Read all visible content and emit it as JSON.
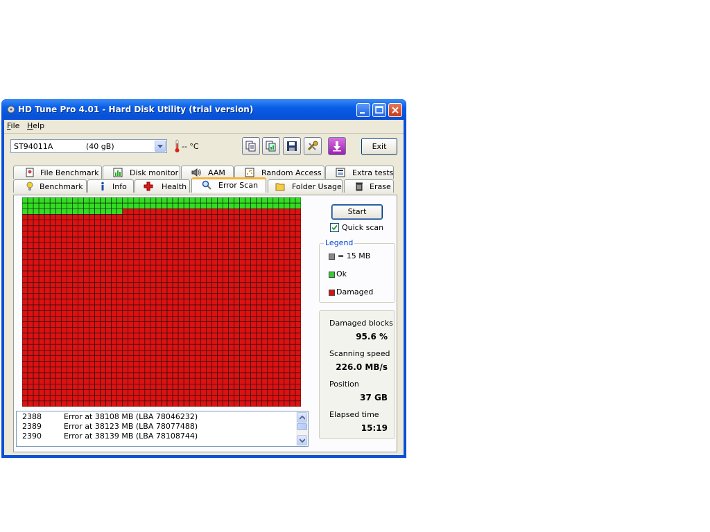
{
  "window": {
    "title": "HD Tune Pro 4.01 - Hard Disk Utility (trial version)"
  },
  "menu": {
    "items": [
      "File",
      "Help"
    ]
  },
  "toolbar": {
    "drive_model": "ST94011A",
    "drive_size": "(40 gB)",
    "temperature": "-- °C",
    "exit_label": "Exit",
    "icon_buttons": [
      "copy-text-icon",
      "copy-screenshot-icon",
      "save-icon",
      "options-icon",
      "download-icon"
    ]
  },
  "tabs": {
    "row1": [
      {
        "label": "File Benchmark",
        "icon": "file-benchmark-icon"
      },
      {
        "label": "Disk monitor",
        "icon": "disk-monitor-icon"
      },
      {
        "label": "AAM",
        "icon": "speaker-icon"
      },
      {
        "label": "Random Access",
        "icon": "random-access-icon"
      },
      {
        "label": "Extra tests",
        "icon": "extra-tests-icon"
      }
    ],
    "row2": [
      {
        "label": "Benchmark",
        "icon": "lightbulb-icon"
      },
      {
        "label": "Info",
        "icon": "info-icon"
      },
      {
        "label": "Health",
        "icon": "health-cross-icon"
      },
      {
        "label": "Error Scan",
        "icon": "magnifier-icon",
        "active": true
      },
      {
        "label": "Folder Usage",
        "icon": "folder-icon"
      },
      {
        "label": "Erase",
        "icon": "trash-icon"
      }
    ]
  },
  "scan": {
    "grid": {
      "columns": 50,
      "rows": 37
    },
    "ok_blocks": 118,
    "colors": {
      "ok": "#33dd22",
      "damaged": "#dd1111",
      "line": "#111111"
    },
    "start_label": "Start",
    "quick_scan_label": "Quick scan",
    "quick_scan_checked": true
  },
  "legend": {
    "title": "Legend",
    "items": [
      {
        "label": "= 15 MB",
        "color": "#888888"
      },
      {
        "label": "Ok",
        "color": "#33cc33"
      },
      {
        "label": "Damaged",
        "color": "#dd1111"
      }
    ]
  },
  "stats": {
    "damaged_blocks_label": "Damaged blocks",
    "damaged_blocks_value": "95.6 %",
    "scanning_speed_label": "Scanning speed",
    "scanning_speed_value": "226.0 MB/s",
    "position_label": "Position",
    "position_value": "37 GB",
    "elapsed_label": "Elapsed time",
    "elapsed_value": "15:19"
  },
  "log": {
    "rows": [
      {
        "num": "2388",
        "msg": "Error at 38108 MB (LBA 78046232)"
      },
      {
        "num": "2389",
        "msg": "Error at 38123 MB (LBA 78077488)"
      },
      {
        "num": "2390",
        "msg": "Error at 38139 MB (LBA 78108744)"
      }
    ]
  }
}
